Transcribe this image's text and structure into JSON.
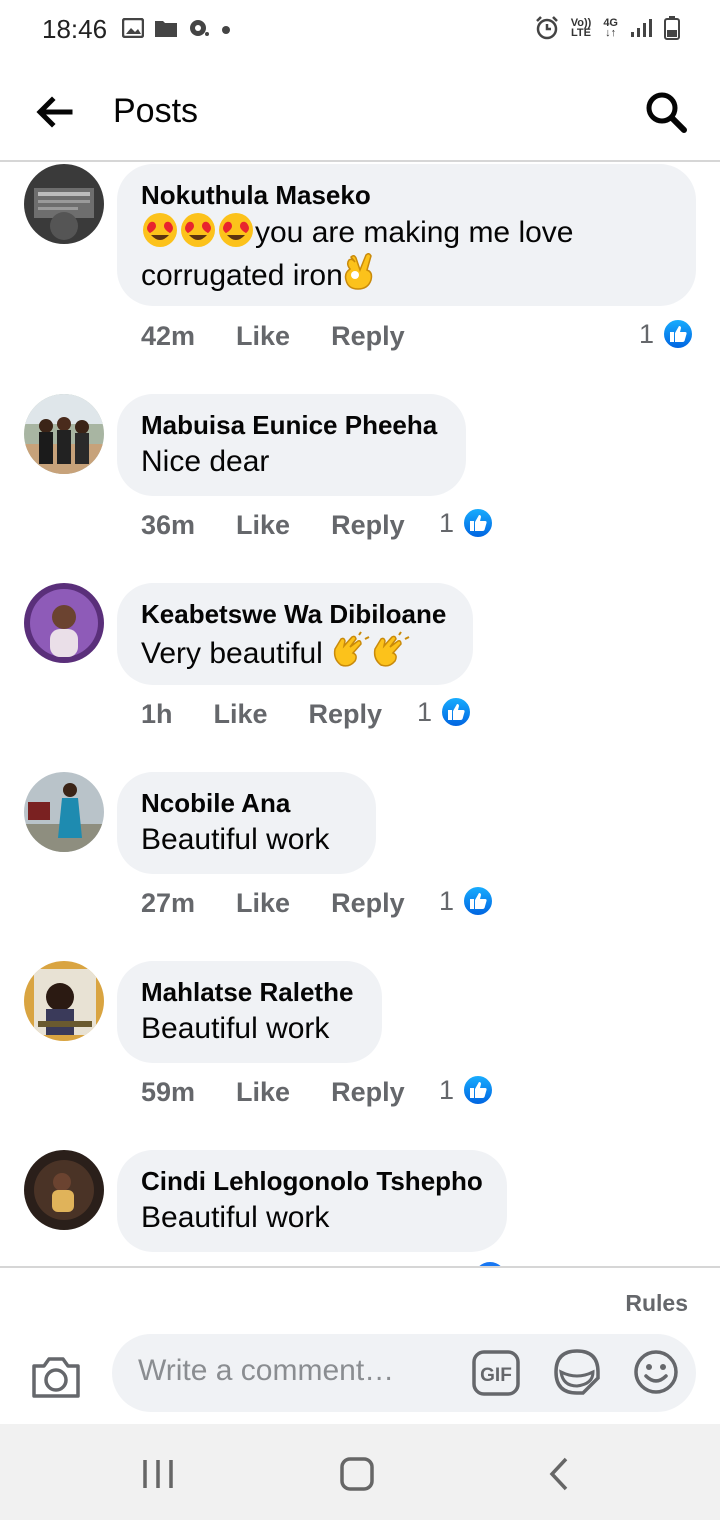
{
  "status_bar": {
    "time": "18:46",
    "volte": "Vo))",
    "lte": "LTE",
    "network": "4G"
  },
  "header": {
    "title": "Posts"
  },
  "comments": [
    {
      "author": "Nokuthula Maseko",
      "text": "you are making me love",
      "text_line2": "corrugated iron",
      "time": "42m",
      "like": "Like",
      "reply": "Reply",
      "reactions": "1"
    },
    {
      "author": "Mabuisa Eunice Pheeha",
      "text": "Nice dear",
      "time": "36m",
      "like": "Like",
      "reply": "Reply",
      "reactions": "1"
    },
    {
      "author": "Keabetswe Wa Dibiloane",
      "text": "Very beautiful ",
      "time": "1h",
      "like": "Like",
      "reply": "Reply",
      "reactions": "1"
    },
    {
      "author": "Ncobile Ana",
      "text": "Beautiful work",
      "time": "27m",
      "like": "Like",
      "reply": "Reply",
      "reactions": "1"
    },
    {
      "author": "Mahlatse Ralethe",
      "text": "Beautiful work",
      "time": "59m",
      "like": "Like",
      "reply": "Reply",
      "reactions": "1"
    },
    {
      "author": "Cindi Lehlogonolo Tshepho",
      "text": "Beautiful work"
    }
  ],
  "compose": {
    "rules": "Rules",
    "placeholder": "Write a comment…"
  },
  "colors": {
    "like_blue": "#0866ff",
    "bubble_bg": "#f0f2f5",
    "meta_gray": "#65676b"
  },
  "icons": [
    "back-arrow-icon",
    "search-icon",
    "like-thumb-icon",
    "camera-icon",
    "gif-icon",
    "sticker-icon",
    "emoji-icon",
    "recent-apps-icon",
    "home-icon",
    "back-icon"
  ]
}
